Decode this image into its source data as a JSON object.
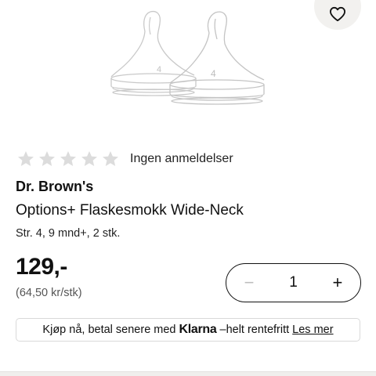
{
  "product_image": {
    "nipple_size_mark": "4"
  },
  "rating": {
    "stars_filled": 0,
    "stars_total": 5,
    "label": "Ingen anmeldelser"
  },
  "product": {
    "brand": "Dr. Brown's",
    "name": "Options+ Flaskesmokk Wide-Neck",
    "variant": "Str. 4, 9 mnd+, 2 stk.",
    "price": "129,-",
    "unit_price": "(64,50 kr/stk)"
  },
  "quantity": {
    "minus_label": "−",
    "value": "1",
    "plus_label": "+"
  },
  "klarna": {
    "text_before": "Kjøp nå, betal senere med",
    "logo": "Klarna",
    "text_after": "–helt rentefritt",
    "link": "Les mer"
  },
  "colors": {
    "star_empty": "#dcdcdc",
    "wishlist_bg": "#f2f1ef",
    "border": "#d9d9d9"
  },
  "icons": [
    "heart-icon",
    "star-icon",
    "minus-icon",
    "plus-icon"
  ]
}
